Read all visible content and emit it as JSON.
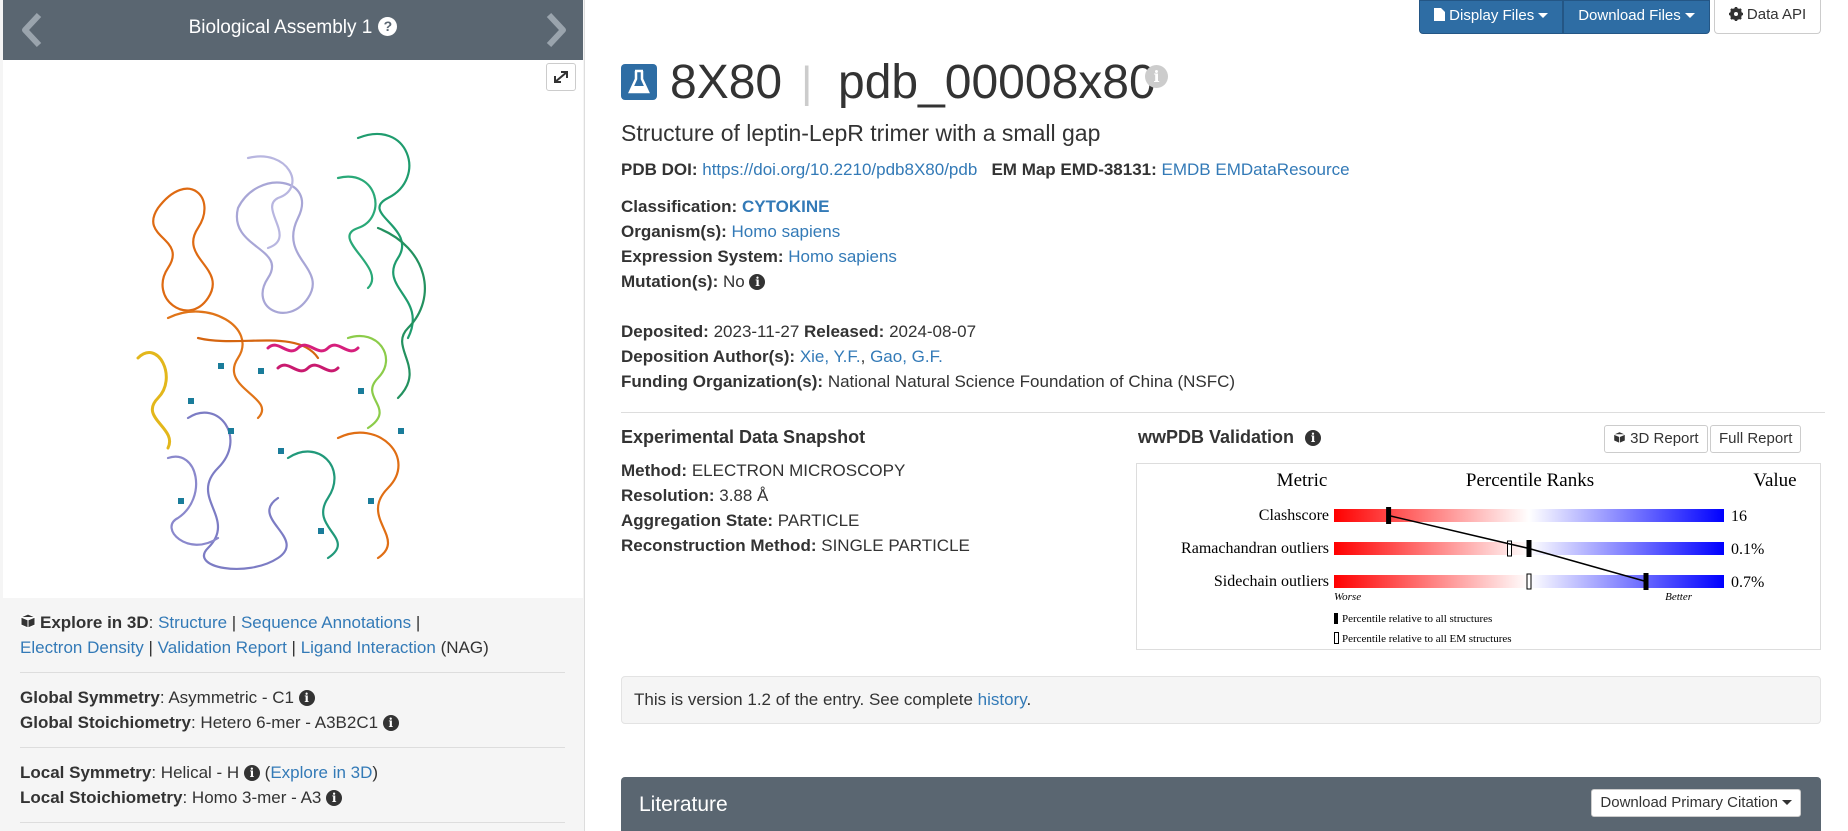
{
  "carousel": {
    "title": "Biological Assembly 1",
    "help": "?"
  },
  "top_buttons": {
    "display_files": "Display Files",
    "download_files": "Download Files",
    "data_api": "Data API"
  },
  "header": {
    "id": "8X80",
    "separator": "|",
    "extended_id": "pdb_00008x80",
    "info": "i",
    "subtitle": "Structure of leptin-LepR trimer with a small gap"
  },
  "doi": {
    "label": "PDB DOI:",
    "link": "https://doi.org/10.2210/pdb8X80/pdb",
    "emmap_label": "EM Map EMD-38131:",
    "emdb": "EMDB",
    "emdataresource": "EMDataResource"
  },
  "meta": {
    "classification_label": "Classification:",
    "classification": "CYTOKINE",
    "organism_label": "Organism(s):",
    "organism": "Homo sapiens",
    "expression_label": "Expression System:",
    "expression": "Homo sapiens",
    "mutation_label": "Mutation(s):",
    "mutation": "No",
    "deposited_label": "Deposited:",
    "deposited": "2023-11-27",
    "released_label": "Released:",
    "released": "2024-08-07",
    "authors_label": "Deposition Author(s):",
    "author1": "Xie, Y.F.",
    "author_sep": ", ",
    "author2": "Gao, G.F.",
    "funding_label": "Funding Organization(s):",
    "funding": "National Natural Science Foundation of China (NSFC)"
  },
  "snapshot": {
    "title": "Experimental Data Snapshot",
    "method_label": "Method:",
    "method": "ELECTRON MICROSCOPY",
    "resolution_label": "Resolution:",
    "resolution": "3.88 Å",
    "aggregation_label": "Aggregation State:",
    "aggregation": "PARTICLE",
    "reconstruction_label": "Reconstruction Method:",
    "reconstruction": "SINGLE PARTICLE"
  },
  "validation": {
    "title": "wwPDB Validation",
    "report3d": "3D Report",
    "full_report": "Full Report",
    "header_metric": "Metric",
    "header_ranks": "Percentile Ranks",
    "header_value": "Value",
    "rows": [
      {
        "metric": "Clashscore",
        "value": "16",
        "all": 0.14,
        "em": null
      },
      {
        "metric": "Ramachandran outliers",
        "value": "0.1%",
        "all": 0.5,
        "em": 0.45
      },
      {
        "metric": "Sidechain outliers",
        "value": "0.7%",
        "all": 0.8,
        "em": 0.5
      }
    ],
    "worse": "Worse",
    "better": "Better",
    "legend_all": "Percentile relative to all structures",
    "legend_em": "Percentile relative to all EM structures"
  },
  "version": {
    "pre": "This is version 1.2 of the entry. See complete ",
    "link": "history",
    "post": "."
  },
  "literature": {
    "title": "Literature",
    "button": "Download Primary Citation"
  },
  "left_info": {
    "explore_label": "Explore in 3D",
    "colon": ": ",
    "structure": "Structure",
    "seq_annot": "Sequence Annotations",
    "electron_density": "Electron Density",
    "validation_report": "Validation Report",
    "ligand_interaction": "Ligand Interaction",
    "ligand": "(NAG)",
    "global_symmetry_label": "Global Symmetry",
    "global_symmetry": ": Asymmetric - C1",
    "global_stoich_label": "Global Stoichiometry",
    "global_stoich": ": Hetero 6-mer - A3B2C1",
    "local_symmetry_label": "Local Symmetry",
    "local_symmetry": ": Helical - H",
    "explore_3d_link": "Explore in 3D",
    "local_stoich_label": "Local Stoichiometry",
    "local_stoich": ": Homo 3-mer - A3"
  },
  "colors": {
    "header_bar": "#5a6671",
    "primary_button": "#2e6da4",
    "link": "#337ab7",
    "slider_bad": "#ff0000",
    "slider_good": "#0000ff"
  }
}
